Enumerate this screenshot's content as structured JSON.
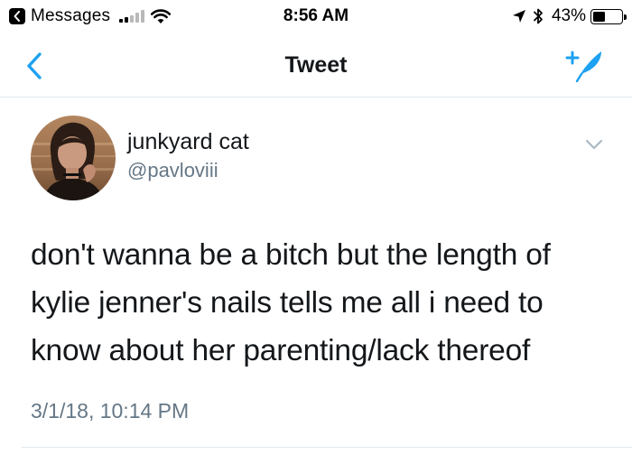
{
  "status_bar": {
    "back_app": "Messages",
    "time": "8:56 AM",
    "battery_percent": "43%",
    "battery_level": 0.43,
    "signal_bars_filled": 2,
    "signal_bars_total": 5,
    "icons": [
      "back-chevron-icon",
      "signal-icon",
      "wifi-icon",
      "location-arrow-icon",
      "bluetooth-icon",
      "battery-icon"
    ]
  },
  "nav": {
    "title": "Tweet",
    "back_icon": "chevron-left-icon",
    "compose_icon": "compose-tweet-icon",
    "accent_color": "#1da1f2"
  },
  "tweet": {
    "display_name": "junkyard cat",
    "handle": "@pavloviii",
    "text": "don't wanna be a bitch but the length of kylie jenner's nails tells me all i need to know about her parenting/lack thereof",
    "timestamp": "3/1/18, 10:14 PM",
    "menu_icon": "chevron-down-icon"
  },
  "colors": {
    "text_primary": "#14171a",
    "text_secondary": "#657786",
    "divider": "#e1e8ed",
    "accent": "#1da1f2"
  }
}
